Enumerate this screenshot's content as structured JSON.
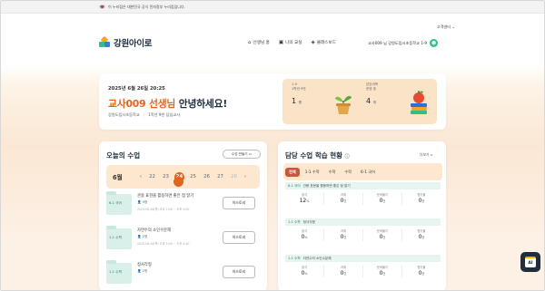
{
  "gov_bar": {
    "text": "이 누리집은 대한민국 공식 전자정부 누리집입니다."
  },
  "header": {
    "support": "고객센터 ⌄",
    "logo": "강원아이로",
    "nav": [
      {
        "label": "선생님 홈",
        "icon": "home-icon",
        "glyph": "⌂"
      },
      {
        "label": "나의 교실",
        "icon": "classroom-icon",
        "glyph": "▣"
      },
      {
        "label": "클래스보드",
        "icon": "classboard-icon",
        "glyph": "◈"
      }
    ],
    "user": "교사009 님 강원도립시초등학교 1-9",
    "accent": "#2fbf8f"
  },
  "hero": {
    "date": "2025년 6월 26일 20:25",
    "name": "교사009 선생님",
    "greet": " 안녕하세요!",
    "school": "강원도립시초등학교",
    "role": "1학년 9반 담임교사",
    "stat1_label1": "1-9",
    "stat1_label2": "1학년 9반",
    "stat1_value": "1",
    "stat1_unit": "명",
    "stat2_label1": "담당과목",
    "stat2_label2": "운영 중",
    "stat2_value": "4",
    "stat2_unit": "개",
    "accent": "#e2641f"
  },
  "today": {
    "title": "오늘의 수업",
    "make_button": "수업 만들기 ▭",
    "month": "6월",
    "days": [
      "22",
      "23",
      "24",
      "25",
      "26",
      "27",
      "28"
    ],
    "today_index": 2,
    "dots": "•••••",
    "lessons": [
      {
        "folder": "6-1 국어",
        "title": "관용 표현을 활용하면 좋은 점 알기",
        "members": "9명",
        "date": "2025.06.26(목) 오후 2:00 ~ 오후 4:00",
        "button": "히스토리"
      },
      {
        "folder": "1-1 수학",
        "title": "자연수의 소인수분해",
        "members": "2명",
        "date": "2025.06.26(목) 오후 5:00 ~ 오후 5:40",
        "button": "히스토리"
      },
      {
        "folder": "1-1 수학",
        "title": "정사각형",
        "members": "2명",
        "date": "",
        "button": "히스토리"
      }
    ]
  },
  "status": {
    "title": "담당 수업 학습 현황",
    "more": "더보기 >",
    "tabs": [
      "전체",
      "1-1 수학",
      "수학",
      "수학",
      "6-1 국어"
    ],
    "sections": [
      {
        "tag": "6-1 국어",
        "name": "관용 표현을 활용하면 좋은 점 알기",
        "cols": [
          {
            "label": "출석",
            "value": "12",
            "unit": "%"
          },
          {
            "label": "과제",
            "value": "0",
            "unit": "건"
          },
          {
            "label": "문제풀이",
            "value": "0",
            "unit": "건"
          },
          {
            "label": "평가물",
            "value": "0",
            "unit": "건"
          }
        ]
      },
      {
        "tag": "1-1 수학",
        "name": "정사각형",
        "cols": [
          {
            "label": "출석",
            "value": "0",
            "unit": "%"
          },
          {
            "label": "과제",
            "value": "0",
            "unit": "건"
          },
          {
            "label": "문제풀이",
            "value": "0",
            "unit": "건"
          },
          {
            "label": "평가물",
            "value": "0",
            "unit": "건"
          }
        ]
      },
      {
        "tag": "1-1 수학",
        "name": "자연수의 소인수분해",
        "cols": [
          {
            "label": "출석",
            "value": "0",
            "unit": "%"
          },
          {
            "label": "과제",
            "value": "0",
            "unit": "건"
          },
          {
            "label": "문제풀이",
            "value": "0",
            "unit": "건"
          },
          {
            "label": "평가물",
            "value": "0",
            "unit": "건"
          }
        ]
      }
    ]
  },
  "float_button": {
    "label": "AI"
  }
}
